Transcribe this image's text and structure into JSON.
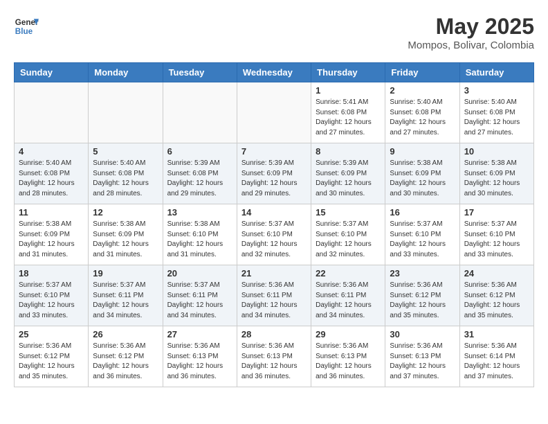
{
  "header": {
    "logo_line1": "General",
    "logo_line2": "Blue",
    "main_title": "May 2025",
    "subtitle": "Mompos, Bolivar, Colombia"
  },
  "days_of_week": [
    "Sunday",
    "Monday",
    "Tuesday",
    "Wednesday",
    "Thursday",
    "Friday",
    "Saturday"
  ],
  "weeks": [
    [
      {
        "day": "",
        "info": ""
      },
      {
        "day": "",
        "info": ""
      },
      {
        "day": "",
        "info": ""
      },
      {
        "day": "",
        "info": ""
      },
      {
        "day": "1",
        "info": "Sunrise: 5:41 AM\nSunset: 6:08 PM\nDaylight: 12 hours\nand 27 minutes."
      },
      {
        "day": "2",
        "info": "Sunrise: 5:40 AM\nSunset: 6:08 PM\nDaylight: 12 hours\nand 27 minutes."
      },
      {
        "day": "3",
        "info": "Sunrise: 5:40 AM\nSunset: 6:08 PM\nDaylight: 12 hours\nand 27 minutes."
      }
    ],
    [
      {
        "day": "4",
        "info": "Sunrise: 5:40 AM\nSunset: 6:08 PM\nDaylight: 12 hours\nand 28 minutes."
      },
      {
        "day": "5",
        "info": "Sunrise: 5:40 AM\nSunset: 6:08 PM\nDaylight: 12 hours\nand 28 minutes."
      },
      {
        "day": "6",
        "info": "Sunrise: 5:39 AM\nSunset: 6:08 PM\nDaylight: 12 hours\nand 29 minutes."
      },
      {
        "day": "7",
        "info": "Sunrise: 5:39 AM\nSunset: 6:09 PM\nDaylight: 12 hours\nand 29 minutes."
      },
      {
        "day": "8",
        "info": "Sunrise: 5:39 AM\nSunset: 6:09 PM\nDaylight: 12 hours\nand 30 minutes."
      },
      {
        "day": "9",
        "info": "Sunrise: 5:38 AM\nSunset: 6:09 PM\nDaylight: 12 hours\nand 30 minutes."
      },
      {
        "day": "10",
        "info": "Sunrise: 5:38 AM\nSunset: 6:09 PM\nDaylight: 12 hours\nand 30 minutes."
      }
    ],
    [
      {
        "day": "11",
        "info": "Sunrise: 5:38 AM\nSunset: 6:09 PM\nDaylight: 12 hours\nand 31 minutes."
      },
      {
        "day": "12",
        "info": "Sunrise: 5:38 AM\nSunset: 6:09 PM\nDaylight: 12 hours\nand 31 minutes."
      },
      {
        "day": "13",
        "info": "Sunrise: 5:38 AM\nSunset: 6:10 PM\nDaylight: 12 hours\nand 31 minutes."
      },
      {
        "day": "14",
        "info": "Sunrise: 5:37 AM\nSunset: 6:10 PM\nDaylight: 12 hours\nand 32 minutes."
      },
      {
        "day": "15",
        "info": "Sunrise: 5:37 AM\nSunset: 6:10 PM\nDaylight: 12 hours\nand 32 minutes."
      },
      {
        "day": "16",
        "info": "Sunrise: 5:37 AM\nSunset: 6:10 PM\nDaylight: 12 hours\nand 33 minutes."
      },
      {
        "day": "17",
        "info": "Sunrise: 5:37 AM\nSunset: 6:10 PM\nDaylight: 12 hours\nand 33 minutes."
      }
    ],
    [
      {
        "day": "18",
        "info": "Sunrise: 5:37 AM\nSunset: 6:10 PM\nDaylight: 12 hours\nand 33 minutes."
      },
      {
        "day": "19",
        "info": "Sunrise: 5:37 AM\nSunset: 6:11 PM\nDaylight: 12 hours\nand 34 minutes."
      },
      {
        "day": "20",
        "info": "Sunrise: 5:37 AM\nSunset: 6:11 PM\nDaylight: 12 hours\nand 34 minutes."
      },
      {
        "day": "21",
        "info": "Sunrise: 5:36 AM\nSunset: 6:11 PM\nDaylight: 12 hours\nand 34 minutes."
      },
      {
        "day": "22",
        "info": "Sunrise: 5:36 AM\nSunset: 6:11 PM\nDaylight: 12 hours\nand 34 minutes."
      },
      {
        "day": "23",
        "info": "Sunrise: 5:36 AM\nSunset: 6:12 PM\nDaylight: 12 hours\nand 35 minutes."
      },
      {
        "day": "24",
        "info": "Sunrise: 5:36 AM\nSunset: 6:12 PM\nDaylight: 12 hours\nand 35 minutes."
      }
    ],
    [
      {
        "day": "25",
        "info": "Sunrise: 5:36 AM\nSunset: 6:12 PM\nDaylight: 12 hours\nand 35 minutes."
      },
      {
        "day": "26",
        "info": "Sunrise: 5:36 AM\nSunset: 6:12 PM\nDaylight: 12 hours\nand 36 minutes."
      },
      {
        "day": "27",
        "info": "Sunrise: 5:36 AM\nSunset: 6:13 PM\nDaylight: 12 hours\nand 36 minutes."
      },
      {
        "day": "28",
        "info": "Sunrise: 5:36 AM\nSunset: 6:13 PM\nDaylight: 12 hours\nand 36 minutes."
      },
      {
        "day": "29",
        "info": "Sunrise: 5:36 AM\nSunset: 6:13 PM\nDaylight: 12 hours\nand 36 minutes."
      },
      {
        "day": "30",
        "info": "Sunrise: 5:36 AM\nSunset: 6:13 PM\nDaylight: 12 hours\nand 37 minutes."
      },
      {
        "day": "31",
        "info": "Sunrise: 5:36 AM\nSunset: 6:14 PM\nDaylight: 12 hours\nand 37 minutes."
      }
    ]
  ]
}
